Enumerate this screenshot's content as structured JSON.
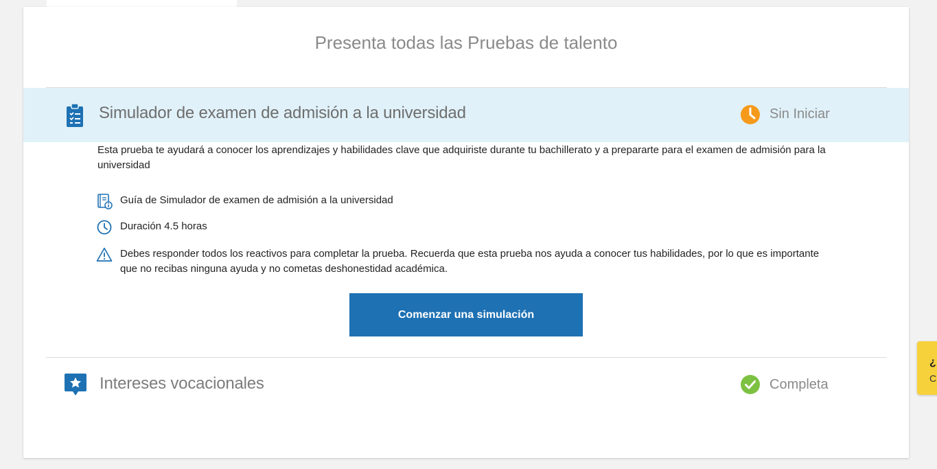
{
  "page": {
    "title": "Presenta todas las Pruebas de talento"
  },
  "tests": {
    "simulator": {
      "title": "Simulador de examen de admisión a la universidad",
      "status": "Sin Iniciar",
      "description": "Esta prueba te ayudará a conocer los aprendizajes y habilidades clave que adquiriste durante tu bachillerato y a prepararte para el examen de admisión para la universidad",
      "guide_link": "Guía de Simulador de examen de admisión a la universidad",
      "duration": "Duración 4.5 horas",
      "warning": "Debes responder todos los reactivos para completar la prueba. Recuerda que esta prueba nos ayuda a conocer tus habilidades, por lo que es importante que no recibas ninguna ayuda y no cometas deshonestidad académica.",
      "start_button": "Comenzar una simulación",
      "icon": "clipboard-checklist-icon"
    },
    "vocational": {
      "title": "Intereses vocacionales",
      "status": "Completa",
      "icon": "star-badge-icon"
    }
  },
  "help_widget": {
    "line1": "¿",
    "line2": "C"
  },
  "colors": {
    "header_bg": "#e0f1f9",
    "primary": "#1e71b3",
    "pending": "#f59a1b",
    "complete": "#7dc142",
    "link": "#1f5f9a",
    "help_bg": "#f7d13b"
  }
}
